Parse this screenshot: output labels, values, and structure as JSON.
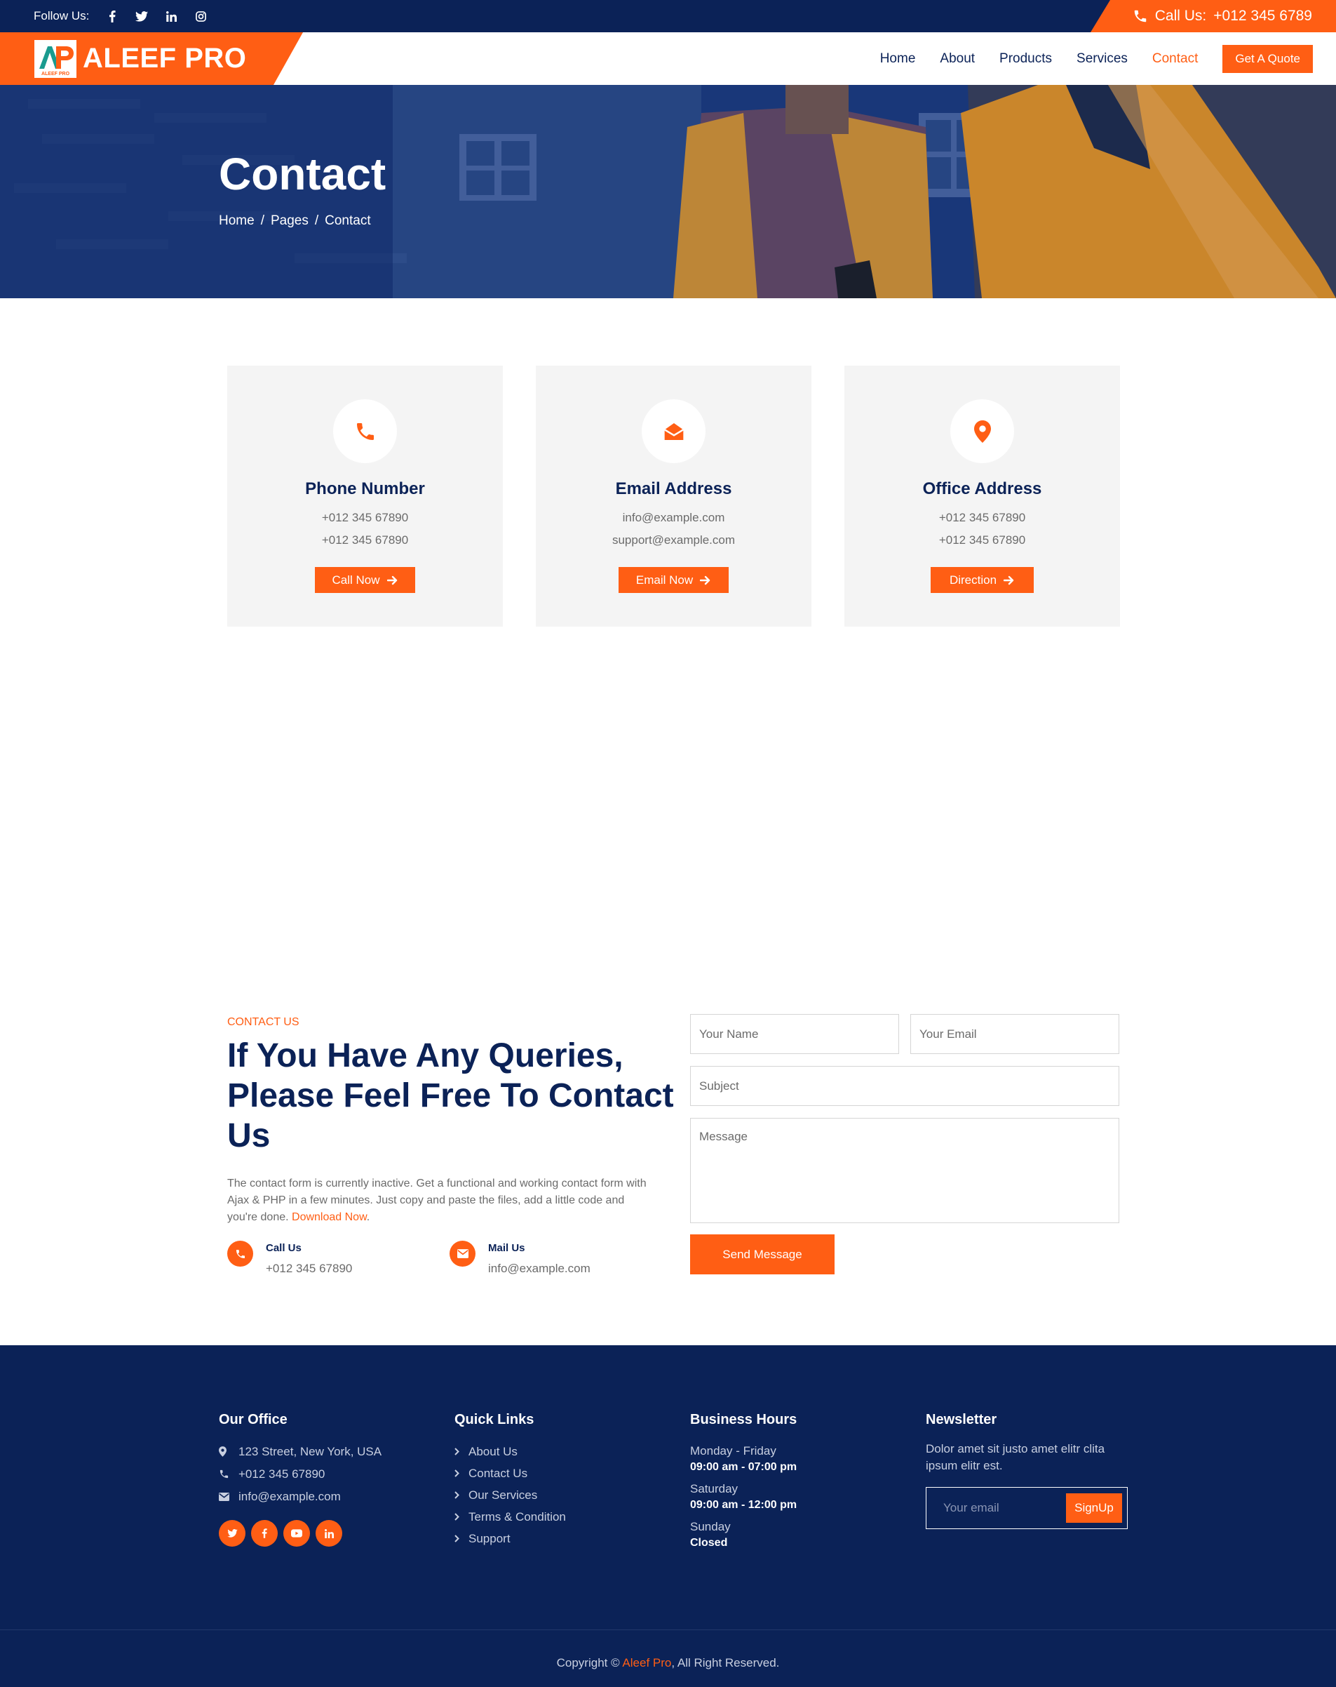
{
  "topbar": {
    "follow_label": "Follow Us:",
    "social": [
      "facebook-icon",
      "twitter-icon",
      "linkedin-icon",
      "instagram-icon"
    ],
    "call_label": "Call Us:",
    "call_number": "+012 345 6789"
  },
  "navbar": {
    "logo_text": "AP",
    "logo_subtext": "ALEEF PRO",
    "brand_name": "ALEEF PRO",
    "links": [
      {
        "label": "Home"
      },
      {
        "label": "About"
      },
      {
        "label": "Products"
      },
      {
        "label": "Services"
      },
      {
        "label": "Contact"
      }
    ],
    "active_index": 4,
    "quote_label": "Get A Quote"
  },
  "hero": {
    "title": "Contact",
    "breadcrumb": [
      "Home",
      "/",
      "Pages",
      "/",
      "Contact"
    ]
  },
  "cards": [
    {
      "icon": "phone-icon",
      "title": "Phone Number",
      "line1": "+012 345 67890",
      "line2": "+012 345 67890",
      "button": "Call Now"
    },
    {
      "icon": "envelope-open-icon",
      "title": "Email Address",
      "line1": "info@example.com",
      "line2": "support@example.com",
      "button": "Email Now"
    },
    {
      "icon": "map-marker-icon",
      "title": "Office Address",
      "line1": "+012 345 67890",
      "line2": "+012 345 67890",
      "button": "Direction"
    }
  ],
  "contact": {
    "kicker": "CONTACT US",
    "heading": "If You Have Any Queries, Please Feel Free To Contact Us",
    "paragraph": "The contact form is currently inactive. Get a functional and working contact form with Ajax & PHP in a few minutes. Just copy and paste the files, add a little code and you're done.",
    "download_link": "Download Now",
    "call": {
      "title": "Call Us",
      "value": "+012 345 67890"
    },
    "mail": {
      "title": "Mail Us",
      "value": "info@example.com"
    },
    "form": {
      "name_placeholder": "Your Name",
      "email_placeholder": "Your Email",
      "subject_placeholder": "Subject",
      "message_placeholder": "Message",
      "send_label": "Send Message"
    }
  },
  "footer": {
    "office": {
      "title": "Our Office",
      "address": "123 Street, New York, USA",
      "phone": "+012 345 67890",
      "email": "info@example.com",
      "social": [
        "twitter-icon",
        "facebook-icon",
        "youtube-icon",
        "linkedin-icon"
      ]
    },
    "quick_links": {
      "title": "Quick Links",
      "items": [
        "About Us",
        "Contact Us",
        "Our Services",
        "Terms & Condition",
        "Support"
      ]
    },
    "hours": {
      "title": "Business Hours",
      "rows": [
        {
          "day": "Monday - Friday",
          "time": "09:00 am - 07:00 pm"
        },
        {
          "day": "Saturday",
          "time": "09:00 am - 12:00 pm"
        },
        {
          "day": "Sunday",
          "time": "Closed"
        }
      ]
    },
    "newsletter": {
      "title": "Newsletter",
      "text": "Dolor amet sit justo amet elitr clita ipsum elitr est.",
      "placeholder": "Your email",
      "button": "SignUp"
    },
    "copyright_prefix": "Copyright ©",
    "copyright_brand": "Aleef Pro",
    "copyright_suffix": ", All Right Reserved."
  },
  "colors": {
    "navy": "#0b2257",
    "orange": "#ff5e14",
    "card_bg": "#f4f4f4",
    "text_gray": "#6b6b6b"
  }
}
